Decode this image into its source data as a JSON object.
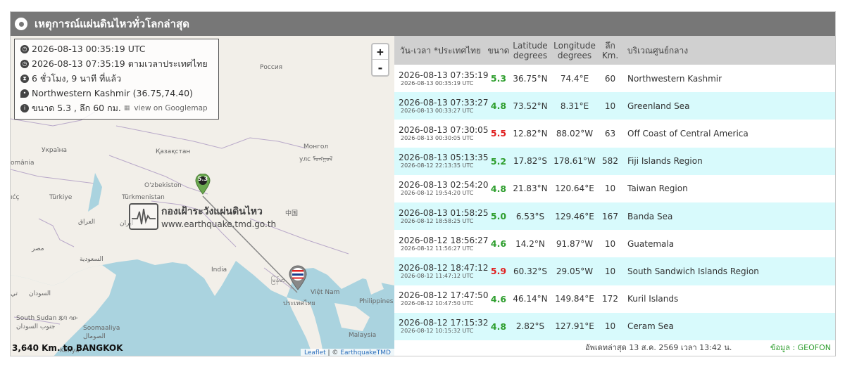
{
  "header": {
    "title": "เหตุการณ์แผ่นดินไหวทั่วโลกล่าสุด"
  },
  "info_box": {
    "utc_time": "2026-08-13 00:35:19 UTC",
    "thai_time": "2026-08-13 07:35:19 ตามเวลาประเทศไทย",
    "elapsed": "6 ชั่วโมง, 9 นาที ที่แล้ว",
    "location": "Northwestern Kashmir (36.75,74.40)",
    "size_depth": "ขนาด 5.3 , ลึก 60 กม.",
    "gmap_link": "view on Googlemap"
  },
  "map": {
    "zoom_in": "+",
    "zoom_out": "-",
    "marker_mag": "5.3",
    "distance": "3,640 Km. to BANGKOK",
    "watermark_th": "กองเฝ้าระวังแผ่นดินไหว",
    "watermark_url": "www.earthquake.tmd.go.th",
    "attrib_leaflet": "Leaflet",
    "attrib_sep": " | © ",
    "attrib_tmd": "EarthquakeTMD",
    "labels": {
      "russia": "Россия",
      "ukraine": "Україна",
      "romania": "omânia",
      "kazakhstan": "Қазақстан",
      "mongolia": "Монгол",
      "mongolia2": "улс ᠮᠣᠩᠭᠣᠯ",
      "uzbekistan": "O'zbekiston",
      "turkiye": "Türkiye",
      "turkmenistan": "Türkmenistan",
      "turkiye_left": "ıćç",
      "china": "中国",
      "iraq": "العراق",
      "iran": "ایران",
      "egypt": "مصر",
      "saudi": "السعودية",
      "india": "India",
      "sudan": "السودان",
      "myanmar": "မြန်မာ",
      "vietnam": "Việt Nam",
      "philippines": "Philippines",
      "thailand": "ประเทศไทย",
      "south_sudan": "South Sudan ጁባ ሳዑ",
      "south_sudan2": "جنوب السودان",
      "somaliland": "Soomaaliya",
      "somaliland2": "الصومال",
      "kenya": "Kenya",
      "malaysia": "Malaysia",
      "ti": "تي"
    }
  },
  "table": {
    "headers": {
      "time": "วัน-เวลา *ประเทศไทย",
      "mag": "ขนาด",
      "lat_1": "Latitude",
      "lat_2": "degrees",
      "lon_1": "Longitude",
      "lon_2": "degrees",
      "dep_1": "ลึก",
      "dep_2": "Km.",
      "region": "บริเวณศูนย์กลาง"
    },
    "rows": [
      {
        "time": "2026-08-13 07:35:19",
        "utc": "2026-08-13 00:35:19 UTC",
        "mag": "5.3",
        "mag_color": "#2e9e2e",
        "lat": "36.75°N",
        "lon": "74.4°E",
        "depth": "60",
        "region": "Northwestern Kashmir"
      },
      {
        "time": "2026-08-13 07:33:27",
        "utc": "2026-08-13 00:33:27 UTC",
        "mag": "4.8",
        "mag_color": "#2e9e2e",
        "lat": "73.52°N",
        "lon": "8.31°E",
        "depth": "10",
        "region": "Greenland Sea"
      },
      {
        "time": "2026-08-13 07:30:05",
        "utc": "2026-08-13 00:30:05 UTC",
        "mag": "5.5",
        "mag_color": "#e02020",
        "lat": "12.82°N",
        "lon": "88.02°W",
        "depth": "63",
        "region": "Off Coast of Central America"
      },
      {
        "time": "2026-08-13 05:13:35",
        "utc": "2026-08-12 22:13:35 UTC",
        "mag": "5.2",
        "mag_color": "#2e9e2e",
        "lat": "17.82°S",
        "lon": "178.61°W",
        "depth": "582",
        "region": "Fiji Islands Region"
      },
      {
        "time": "2026-08-13 02:54:20",
        "utc": "2026-08-12 19:54:20 UTC",
        "mag": "4.8",
        "mag_color": "#2e9e2e",
        "lat": "21.83°N",
        "lon": "120.64°E",
        "depth": "10",
        "region": "Taiwan Region"
      },
      {
        "time": "2026-08-13 01:58:25",
        "utc": "2026-08-12 18:58:25 UTC",
        "mag": "5.0",
        "mag_color": "#2e9e2e",
        "lat": "6.53°S",
        "lon": "129.46°E",
        "depth": "167",
        "region": "Banda Sea"
      },
      {
        "time": "2026-08-12 18:56:27",
        "utc": "2026-08-12 11:56:27 UTC",
        "mag": "4.6",
        "mag_color": "#2e9e2e",
        "lat": "14.2°N",
        "lon": "91.87°W",
        "depth": "10",
        "region": "Guatemala"
      },
      {
        "time": "2026-08-12 18:47:12",
        "utc": "2026-08-12 11:47:12 UTC",
        "mag": "5.9",
        "mag_color": "#e02020",
        "lat": "60.32°S",
        "lon": "29.05°W",
        "depth": "10",
        "region": "South Sandwich Islands Region"
      },
      {
        "time": "2026-08-12 17:47:50",
        "utc": "2026-08-12 10:47:50 UTC",
        "mag": "4.6",
        "mag_color": "#2e9e2e",
        "lat": "46.14°N",
        "lon": "149.84°E",
        "depth": "172",
        "region": "Kuril Islands"
      },
      {
        "time": "2026-08-12 17:15:32",
        "utc": "2026-08-12 10:15:32 UTC",
        "mag": "4.8",
        "mag_color": "#2e9e2e",
        "lat": "2.82°S",
        "lon": "127.91°E",
        "depth": "10",
        "region": "Ceram Sea"
      }
    ]
  },
  "footer": {
    "updated": "อัพเดทล่าสุด 13 ส.ค. 2569 เวลา 13:42 น.",
    "source": "ข้อมูล : GEOFON"
  },
  "colors": {
    "header_bg": "#777777",
    "row_alt": "#d8fafc",
    "mag_green": "#2e9e2e",
    "mag_red": "#e02020",
    "marker_green": "#6aa84f",
    "route_line": "#888888"
  }
}
